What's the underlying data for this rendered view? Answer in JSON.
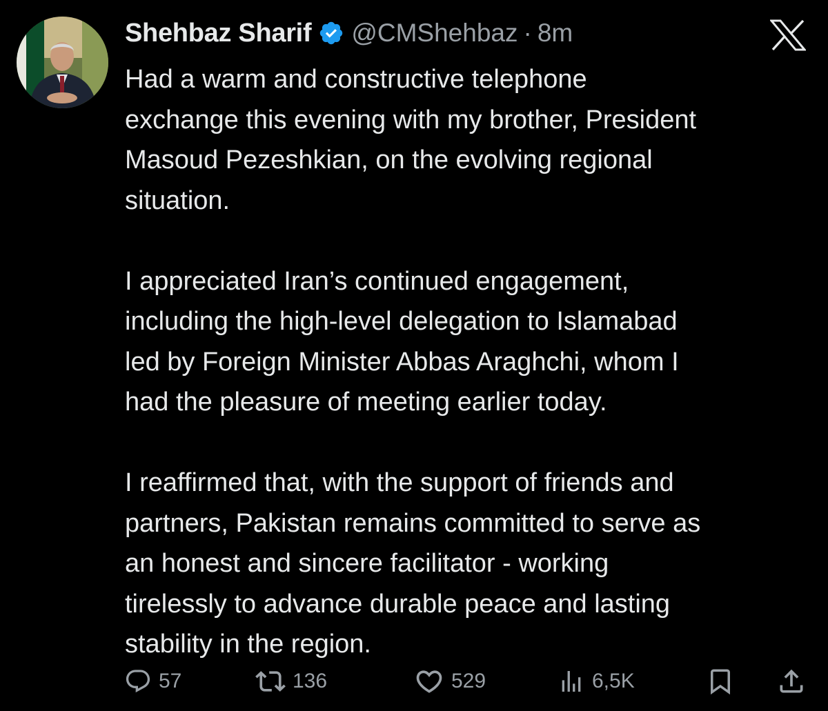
{
  "author": {
    "display_name": "Shehbaz Sharif",
    "handle": "@CMShehbaz",
    "separator": "·",
    "time": "8m",
    "avatar_icon": "profile-photo",
    "verified_icon": "verified-badge-icon"
  },
  "platform_icon": "x-logo-icon",
  "tweet": {
    "paragraphs": [
      "Had a warm and constructive telephone\nexchange this evening with my brother, President\nMasoud Pezeshkian, on the evolving regional\nsituation.",
      "I appreciated Iran’s continued engagement,\nincluding the high-level delegation to Islamabad\nled by Foreign Minister Abbas Araghchi, whom I\nhad the pleasure of meeting earlier today.",
      "I reaffirmed that, with the support of friends and\npartners, Pakistan remains committed to serve as\nan honest and sincere facilitator - working\ntirelessly to advance durable peace and lasting\nstability in the region."
    ]
  },
  "actions": {
    "replies": "57",
    "reposts": "136",
    "likes": "529",
    "views": "6,5K"
  },
  "colors": {
    "background": "#000000",
    "text": "#e7e9ea",
    "muted": "#9aa0a6",
    "verified": "#1d9bf0"
  }
}
